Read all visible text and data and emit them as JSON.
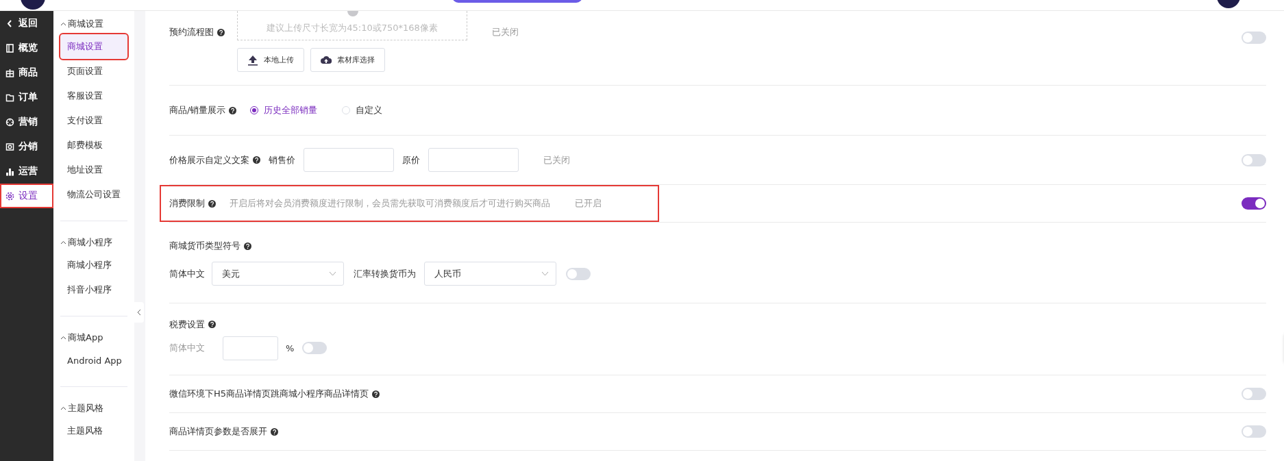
{
  "nav": {
    "items": [
      {
        "label": "返回",
        "selected": false,
        "highlighted": false
      },
      {
        "label": "概览",
        "selected": false,
        "highlighted": false
      },
      {
        "label": "商品",
        "selected": false,
        "highlighted": false
      },
      {
        "label": "订单",
        "selected": false,
        "highlighted": false
      },
      {
        "label": "营销",
        "selected": false,
        "highlighted": false
      },
      {
        "label": "分销",
        "selected": false,
        "highlighted": false
      },
      {
        "label": "运营",
        "selected": false,
        "highlighted": false
      },
      {
        "label": "设置",
        "selected": true,
        "highlighted": true
      }
    ]
  },
  "submenu": {
    "groups": [
      {
        "title": "商城设置",
        "expanded": true,
        "items": [
          {
            "label": "商城设置",
            "selected": true,
            "highlighted": true
          },
          {
            "label": "页面设置",
            "selected": false,
            "highlighted": false
          },
          {
            "label": "客服设置",
            "selected": false,
            "highlighted": false
          },
          {
            "label": "支付设置",
            "selected": false,
            "highlighted": false
          },
          {
            "label": "邮费模板",
            "selected": false,
            "highlighted": false
          },
          {
            "label": "地址设置",
            "selected": false,
            "highlighted": false
          },
          {
            "label": "物流公司设置",
            "selected": false,
            "highlighted": false
          }
        ]
      },
      {
        "title": "商城小程序",
        "expanded": true,
        "items": [
          {
            "label": "商城小程序",
            "selected": false,
            "highlighted": false
          },
          {
            "label": "抖音小程序",
            "selected": false,
            "highlighted": false
          }
        ]
      },
      {
        "title": "商城App",
        "expanded": true,
        "items": [
          {
            "label": "Android App",
            "selected": false,
            "highlighted": false
          }
        ]
      },
      {
        "title": "主题风格",
        "expanded": true,
        "items": [
          {
            "label": "主题风格",
            "selected": false,
            "highlighted": false
          }
        ]
      }
    ]
  },
  "settings": [
    {
      "kind": "upload",
      "label": "预约流程图",
      "hint": "建议上传尺寸长宽为45:10或750*168像素",
      "buttons": [
        "本地上传",
        "素材库选择"
      ],
      "status": "已关闭",
      "on": false,
      "highlighted": false
    },
    {
      "kind": "radio",
      "label": "商品/销量展示",
      "options": [
        {
          "label": "历史全部销量",
          "selected": true
        },
        {
          "label": "自定义",
          "selected": false
        }
      ],
      "highlighted": false
    },
    {
      "kind": "price",
      "label": "价格展示自定义文案",
      "fields": [
        {
          "label": "销售价"
        },
        {
          "label": "原价"
        }
      ],
      "status": "已关闭",
      "on": false,
      "highlighted": false
    },
    {
      "kind": "limit",
      "label": "消费限制",
      "description": "开启后将对会员消费额度进行限制，会员需先获取可消费额度后才可进行购买商品",
      "status": "已开启",
      "on": true,
      "highlighted": true
    },
    {
      "kind": "currency",
      "label": "商城货币类型符号",
      "language": "简体中文",
      "value": "美元",
      "convert_label": "汇率转换货币为",
      "convert_value": "人民币",
      "on": false,
      "highlighted": false
    },
    {
      "kind": "tax",
      "label": "税费设置",
      "language": "简体中文",
      "unit": "%",
      "on": false,
      "highlighted": false
    },
    {
      "kind": "switch",
      "label": "微信环境下H5商品详情页跳商城小程序商品详情页",
      "on": false,
      "highlighted": false
    },
    {
      "kind": "switch",
      "label": "商品详情页参数是否展开",
      "on": false,
      "highlighted": false
    }
  ]
}
